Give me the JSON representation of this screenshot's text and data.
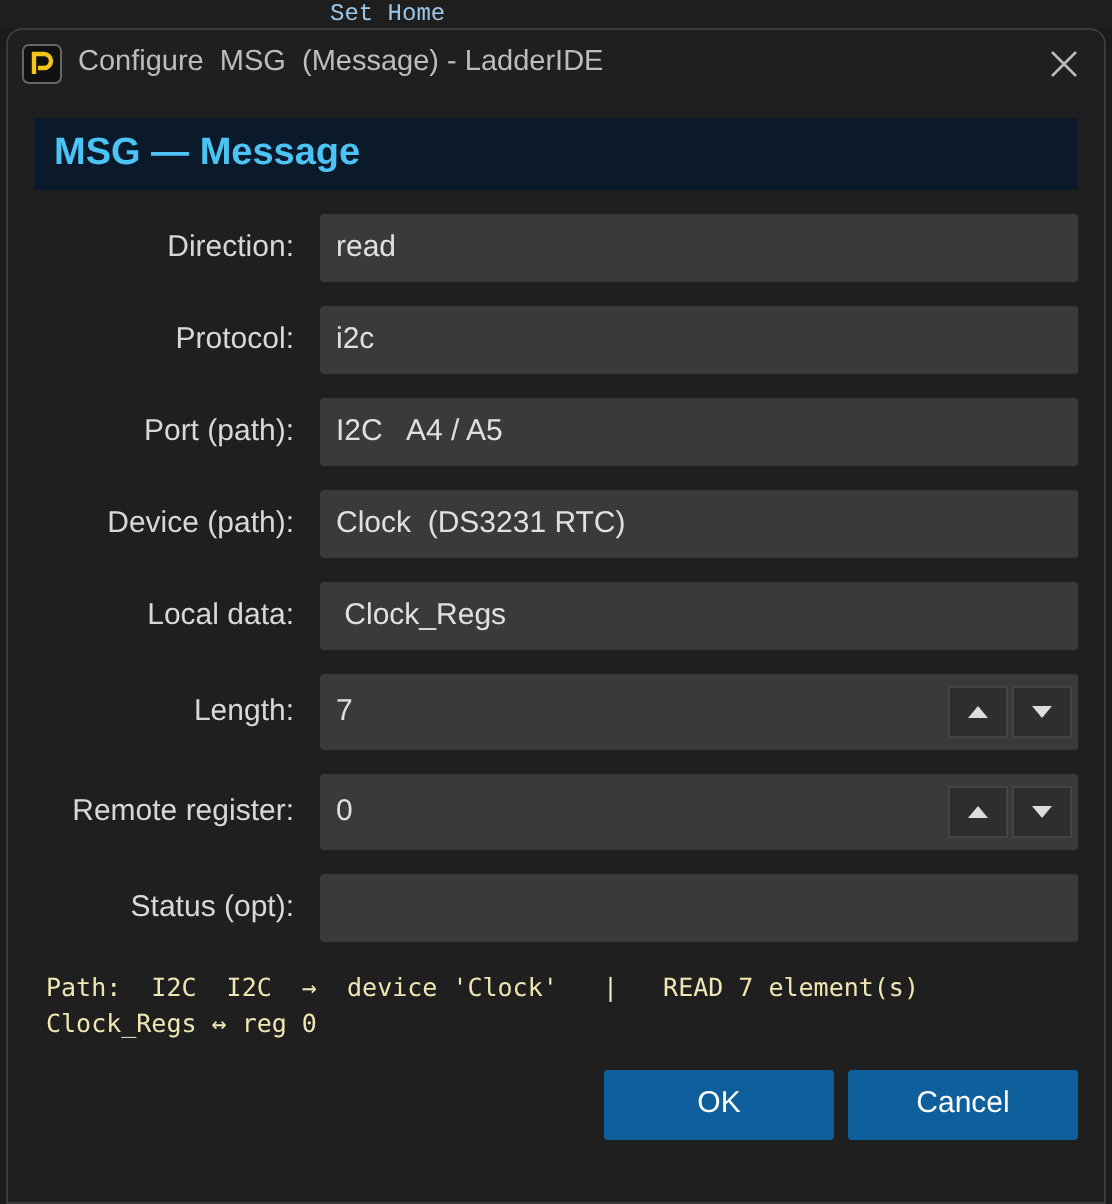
{
  "background": {
    "text": "Set Home"
  },
  "window": {
    "title": "Configure  MSG  (Message) - LadderIDE"
  },
  "header": "MSG — Message",
  "fields": [
    {
      "label": "Direction:",
      "value": "read",
      "kind": "text"
    },
    {
      "label": "Protocol:",
      "value": "i2c",
      "kind": "text"
    },
    {
      "label": "Port (path):",
      "value": "I2C   A4 / A5",
      "kind": "text"
    },
    {
      "label": "Device (path):",
      "value": "Clock  (DS3231 RTC)",
      "kind": "text"
    },
    {
      "label": "Local data:",
      "value": " Clock_Regs",
      "kind": "text"
    },
    {
      "label": "Length:",
      "value": "7",
      "kind": "spin"
    },
    {
      "label": "Remote register:",
      "value": "0",
      "kind": "spin"
    },
    {
      "label": "Status (opt):",
      "kind": "text"
    }
  ],
  "summary": [
    "Path:  I2C  I2C  →  device 'Clock'   |   READ 7 element(s)",
    "Clock_Regs ↔ reg 0"
  ],
  "buttons": [
    "OK",
    "Cancel"
  ]
}
